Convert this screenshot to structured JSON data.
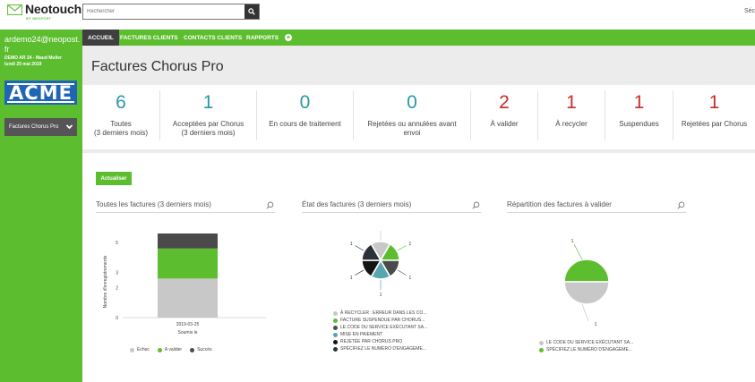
{
  "brand": {
    "name": "Neotouch",
    "tagline": "BY NEOPOST"
  },
  "search": {
    "placeholder": "Rechercher"
  },
  "topright": {
    "label": "Séc"
  },
  "user": {
    "email": "ardemo24@neopost.fr",
    "org": "DEMO AR 24 - Maud Muller",
    "date": "lundi 20 mai 2019"
  },
  "company_logo": {
    "text": "ACME"
  },
  "context": {
    "selected": "Factures Chorus Pro"
  },
  "nav": {
    "items": [
      {
        "label": "ACCUEIL",
        "active": true
      },
      {
        "label": "FACTURES CLIENTS",
        "active": false
      },
      {
        "label": "CONTACTS CLIENTS",
        "active": false
      },
      {
        "label": "RAPPORTS",
        "active": false
      }
    ],
    "add_label": "+"
  },
  "page": {
    "title": "Factures Chorus Pro"
  },
  "stats": [
    {
      "value": "6",
      "label": "Toutes",
      "sublabel": "(3 derniers mois)",
      "color": "teal"
    },
    {
      "value": "1",
      "label": "Acceptées par Chorus",
      "sublabel": "(3 derniers mois)",
      "color": "teal"
    },
    {
      "value": "0",
      "label": "En cours de traitement",
      "sublabel": "",
      "color": "teal"
    },
    {
      "value": "0",
      "label": "Rejetées ou annulées avant",
      "sublabel": "envoi",
      "color": "teal"
    },
    {
      "value": "2",
      "label": "À valider",
      "sublabel": "",
      "color": "red"
    },
    {
      "value": "1",
      "label": "À recycler",
      "sublabel": "",
      "color": "red"
    },
    {
      "value": "1",
      "label": "Suspendues",
      "sublabel": "",
      "color": "red"
    },
    {
      "value": "1",
      "label": "Rejetées par Chorus",
      "sublabel": "",
      "color": "red"
    }
  ],
  "refresh_label": "Actualiser",
  "panels": [
    {
      "title": "Toutes les factures (3 derniers mois)"
    },
    {
      "title": "État des factures (3 derniers mois)"
    },
    {
      "title": "Répartition des factures à valider"
    }
  ],
  "colors": {
    "green": "#5cbd2e",
    "teal": "#2a97a8",
    "red": "#cc2a2a",
    "dark": "#3f3f3f",
    "gray": "#c8c8c8",
    "darkgray": "#4a4a4a"
  },
  "chart_data": [
    {
      "type": "bar",
      "stacked": true,
      "categories": [
        "2019-03-25"
      ],
      "xlabel": "Soumis le",
      "ylabel": "Nombre d'enregistrements",
      "ylim": [
        0,
        5.6
      ],
      "yticks": [
        0,
        2,
        3,
        5
      ],
      "series": [
        {
          "name": "Echec",
          "values": [
            2.6
          ],
          "color": "#c8c8c8"
        },
        {
          "name": "A valider",
          "values": [
            2
          ],
          "color": "#5cbd2e"
        },
        {
          "name": "Succès",
          "values": [
            1
          ],
          "color": "#4a4a4a"
        }
      ]
    },
    {
      "type": "pie",
      "slices": [
        {
          "label": "À RECYCLER : ERREUR DANS LES CO...",
          "value": 1,
          "color": "#c8c8c8"
        },
        {
          "label": "FACTURE SUSPENDUE PAR CHORUS...",
          "value": 1,
          "color": "#5cbd2e"
        },
        {
          "label": "LE CODE DU SERVICE EXÉCUTANT SA...",
          "value": 1,
          "color": "#4a4a4a"
        },
        {
          "label": "MISE EN PAIEMENT",
          "value": 1,
          "color": "#5aa6b0"
        },
        {
          "label": "REJETÉE PAR CHORUS PRO",
          "value": 1,
          "color": "#141414"
        },
        {
          "label": "SPÉCIFIEZ LE NUMÉRO D'ENGAGEME...",
          "value": 1,
          "color": "#2b3138"
        }
      ],
      "data_label": "1"
    },
    {
      "type": "pie",
      "slices": [
        {
          "label": "LE CODE DU SERVICE EXÉCUTANT SA...",
          "value": 1,
          "color": "#c8c8c8"
        },
        {
          "label": "SPÉCIFIEZ LE NUMÉRO D'ENGAGEME...",
          "value": 1,
          "color": "#5cbd2e"
        }
      ],
      "data_label": "1"
    }
  ]
}
